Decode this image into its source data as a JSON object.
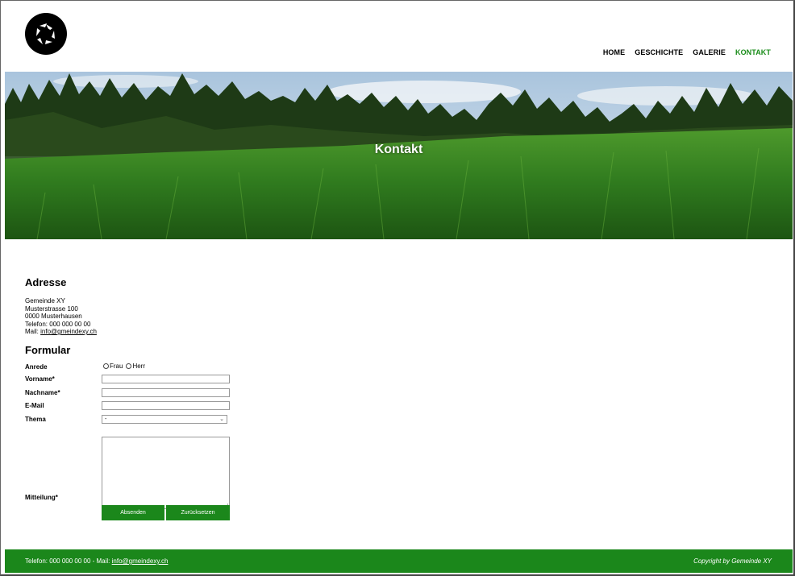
{
  "nav": {
    "items": [
      {
        "label": "HOME",
        "active": false
      },
      {
        "label": "GESCHICHTE",
        "active": false
      },
      {
        "label": "GALERIE",
        "active": false
      },
      {
        "label": "KONTAKT",
        "active": true
      }
    ]
  },
  "hero": {
    "title": "Kontakt"
  },
  "address": {
    "heading": "Adresse",
    "line1": "Gemeinde XY",
    "line2": "Musterstrasse 100",
    "line3": "0000 Musterhausen",
    "phone": "Telefon: 000 000 00 00",
    "mail_prefix": "Mail: ",
    "mail": "info@gmeindexy.ch"
  },
  "form": {
    "heading": "Formular",
    "salutation_label": "Anrede",
    "salutation_options": [
      "Frau",
      "Herr"
    ],
    "firstname_label": "Vorname*",
    "lastname_label": "Nachname*",
    "email_label": "E-Mail",
    "topic_label": "Thema",
    "topic_value": "-",
    "message_label": "Mitteilung*",
    "submit_label": "Absenden",
    "reset_label": "Zurücksetzen"
  },
  "footer": {
    "contact_prefix": "Telefon: 000 000 00 00 - Mail: ",
    "mail": "info@gmeindexy.ch",
    "copyright": "Copyright by Gemeinde XY"
  },
  "colors": {
    "accent": "#1b871b",
    "active_nav": "#1a8c1a"
  },
  "icons": {
    "logo": "aperture-logo-icon",
    "select": "chevron-down-icon"
  }
}
